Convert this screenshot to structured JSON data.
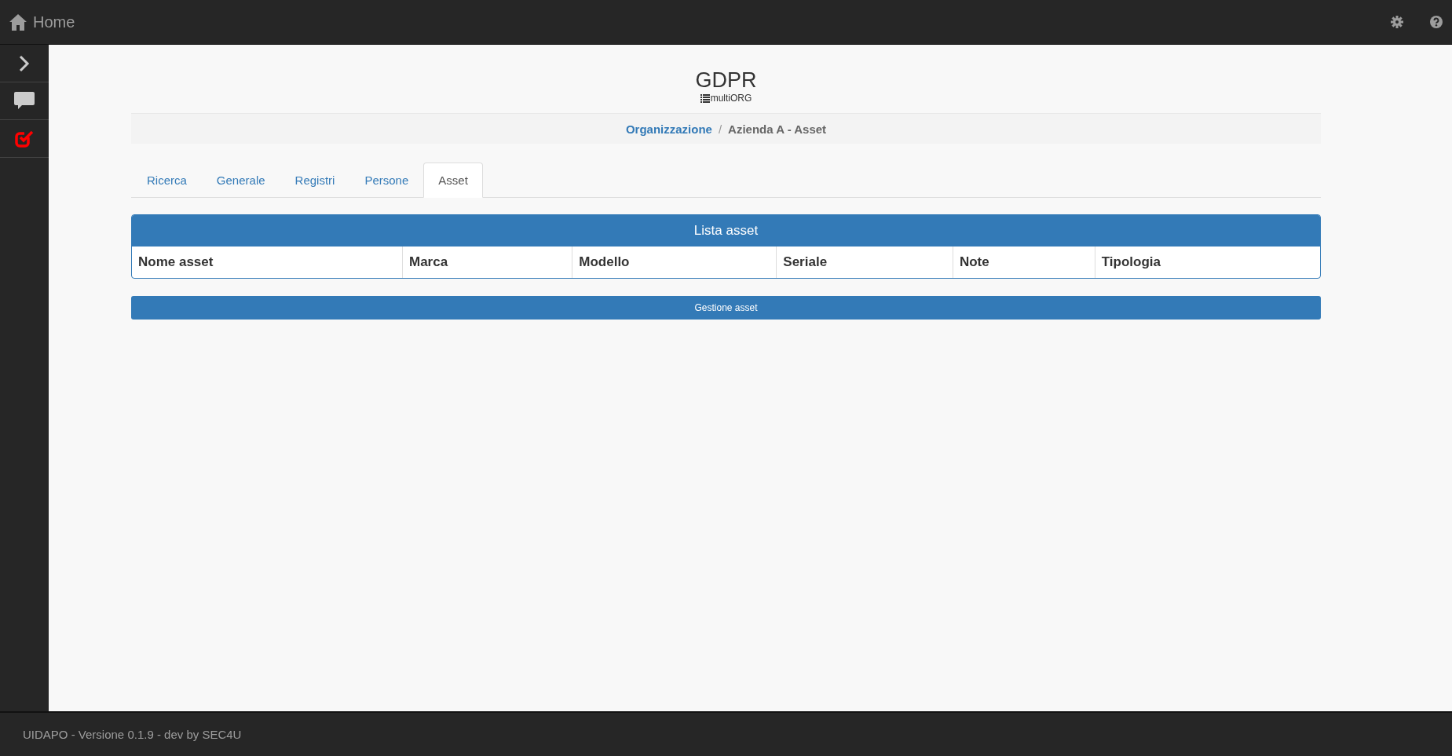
{
  "topbar": {
    "title": "Home"
  },
  "sidebar": {
    "items": [
      {
        "kind": "expand",
        "selected": false
      },
      {
        "kind": "chat",
        "selected": false
      },
      {
        "kind": "tasks",
        "selected": true
      }
    ]
  },
  "header": {
    "title": "GDPR",
    "subtitle": "multiORG"
  },
  "breadcrumb_separator": "/",
  "breadcrumb": [
    {
      "label": "Organizzazione",
      "link": true
    },
    {
      "label": "Azienda A - Asset",
      "link": false
    }
  ],
  "tabs": [
    {
      "label": "Ricerca",
      "selected": false
    },
    {
      "label": "Generale",
      "selected": false
    },
    {
      "label": "Registri",
      "selected": false
    },
    {
      "label": "Persone",
      "selected": false
    },
    {
      "label": "Asset",
      "selected": true
    }
  ],
  "panel": {
    "title": "Lista asset",
    "columns": [
      "Nome asset",
      "Marca",
      "Modello",
      "Seriale",
      "Note",
      "Tipologia"
    ]
  },
  "action_button": "Gestione asset",
  "footer": {
    "text": "UIDAPO - Versione 0.1.9 - dev by SEC4U"
  }
}
